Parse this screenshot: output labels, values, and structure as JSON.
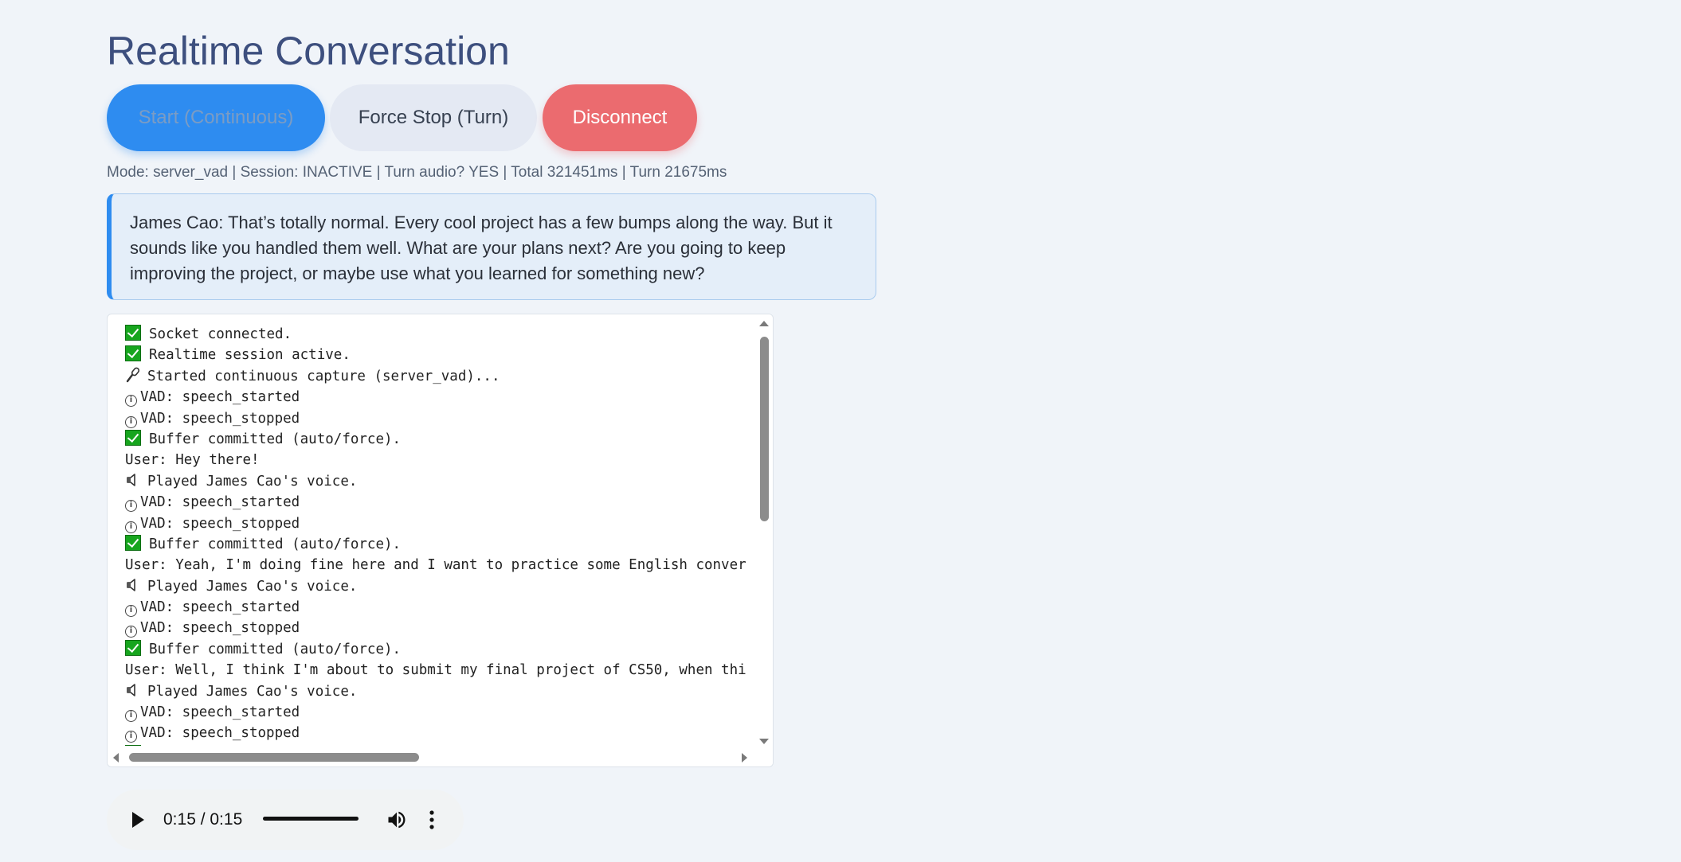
{
  "app": {
    "title": "Realtime Conversation"
  },
  "toolbar": {
    "start_label": "Start (Continuous)",
    "stop_label": "Force Stop (Turn)",
    "disconnect_label": "Disconnect"
  },
  "status": {
    "text": "Mode: server_vad | Session: INACTIVE | Turn audio? YES | Total 321451ms | Turn 21675ms"
  },
  "assistant_message": {
    "text": "James Cao: That’s totally normal. Every cool project has a few bumps along the way. But it sounds like you handled them well. What are your plans next? Are you going to keep improving the project, or maybe use what you learned for something new?"
  },
  "log": {
    "lines": [
      {
        "icon": "check",
        "text": "Socket connected."
      },
      {
        "icon": "check",
        "text": "Realtime session active."
      },
      {
        "icon": "mic",
        "text": "Started continuous capture (server_vad)..."
      },
      {
        "icon": "info",
        "text": "VAD: speech_started"
      },
      {
        "icon": "info",
        "text": "VAD: speech_stopped"
      },
      {
        "icon": "check",
        "text": "Buffer committed (auto/force)."
      },
      {
        "icon": "",
        "text": "User: Hey there!"
      },
      {
        "icon": "speaker",
        "text": "Played James Cao's voice."
      },
      {
        "icon": "info",
        "text": "VAD: speech_started"
      },
      {
        "icon": "info",
        "text": "VAD: speech_stopped"
      },
      {
        "icon": "check",
        "text": "Buffer committed (auto/force)."
      },
      {
        "icon": "",
        "text": "User: Yeah, I'm doing fine here and I want to practice some English conver"
      },
      {
        "icon": "speaker",
        "text": "Played James Cao's voice."
      },
      {
        "icon": "info",
        "text": "VAD: speech_started"
      },
      {
        "icon": "info",
        "text": "VAD: speech_stopped"
      },
      {
        "icon": "check",
        "text": "Buffer committed (auto/force)."
      },
      {
        "icon": "",
        "text": "User: Well, I think I'm about to submit my final project of CS50, when thi"
      },
      {
        "icon": "speaker",
        "text": "Played James Cao's voice."
      },
      {
        "icon": "info",
        "text": "VAD: speech_started"
      },
      {
        "icon": "info",
        "text": "VAD: speech_stopped"
      },
      {
        "icon": "check",
        "text": ""
      }
    ]
  },
  "player": {
    "time": "0:15 / 0:15",
    "progress": 1.0,
    "icons": {
      "play": "play-icon",
      "volume": "volume-icon",
      "more": "more-vertical-icon"
    }
  },
  "colors": {
    "background": "#f0f4f9",
    "title": "#3d4f7e",
    "primary": "#2e8cf0",
    "danger": "#eb6b6f",
    "secondary": "#e4e9f3",
    "success": "#17a51e"
  }
}
